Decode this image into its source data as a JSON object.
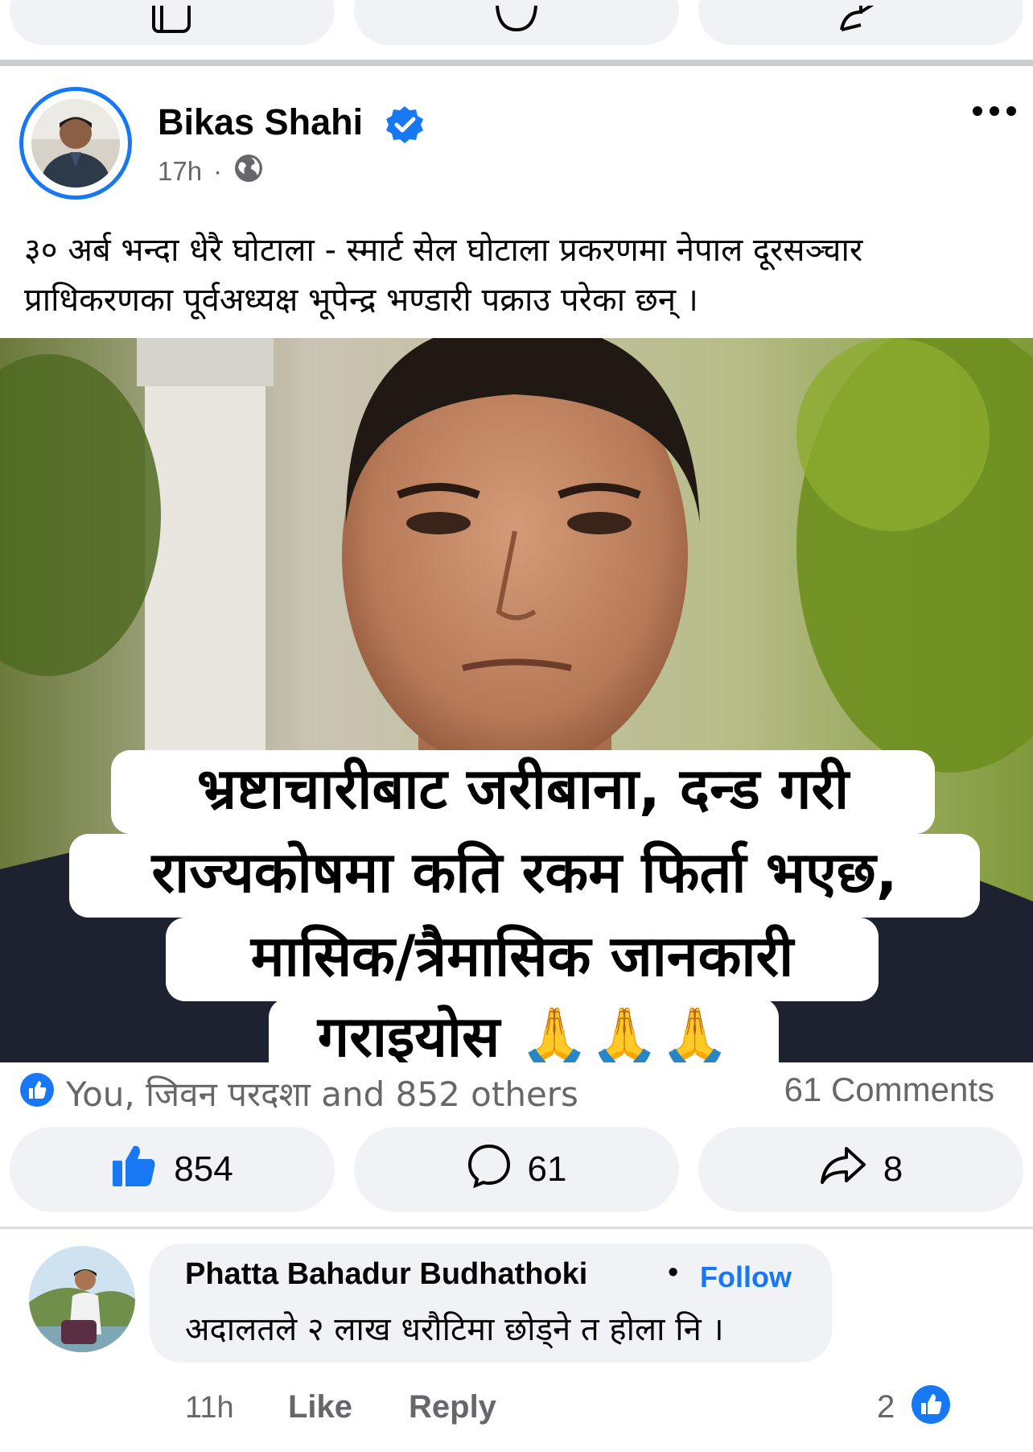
{
  "post": {
    "author": "Bikas Shahi",
    "time": "17h",
    "separator": "·",
    "text": "३० अर्ब भन्दा धेरै घोटाला - स्मार्ट सेल घोटाला प्रकरणमा नेपाल दूरसञ्चार प्राधिकरणका पूर्वअध्यक्ष भूपेन्द्र भण्डारी पक्राउ परेका छन् ।",
    "image_overlay": {
      "line1": "भ्रष्टाचारीबाट जरीबाना, दन्ड गरी",
      "line2": "राज्यकोषमा कति रकम फिर्ता भएछ,",
      "line3": "मासिक/त्रैमासिक जानकारी",
      "line4": "गराइयोस 🙏🙏🙏"
    }
  },
  "reactions": {
    "summary": "You, जिवन परदशा and 852 others",
    "comments": "61 Comments"
  },
  "actions": {
    "like_count": "854",
    "comment_count": "61",
    "share_count": "8"
  },
  "comment": {
    "author": "Phatta Bahadur Budhathoki",
    "dot": "•",
    "follow": "Follow",
    "text": "अदालतले २ लाख धरौटिमा छोड्ने त होला नि ।",
    "time": "11h",
    "like": "Like",
    "reply": "Reply",
    "reaction_count": "2"
  },
  "colors": {
    "brand_blue": "#1877f2",
    "secondary_text": "#65676b",
    "pill_bg": "#f0f2f5"
  },
  "icons": [
    "like-outline-icon",
    "comment-icon",
    "share-icon",
    "verified-badge-icon",
    "globe-icon",
    "more-icon",
    "like-filled-icon",
    "reaction-like-icon"
  ]
}
